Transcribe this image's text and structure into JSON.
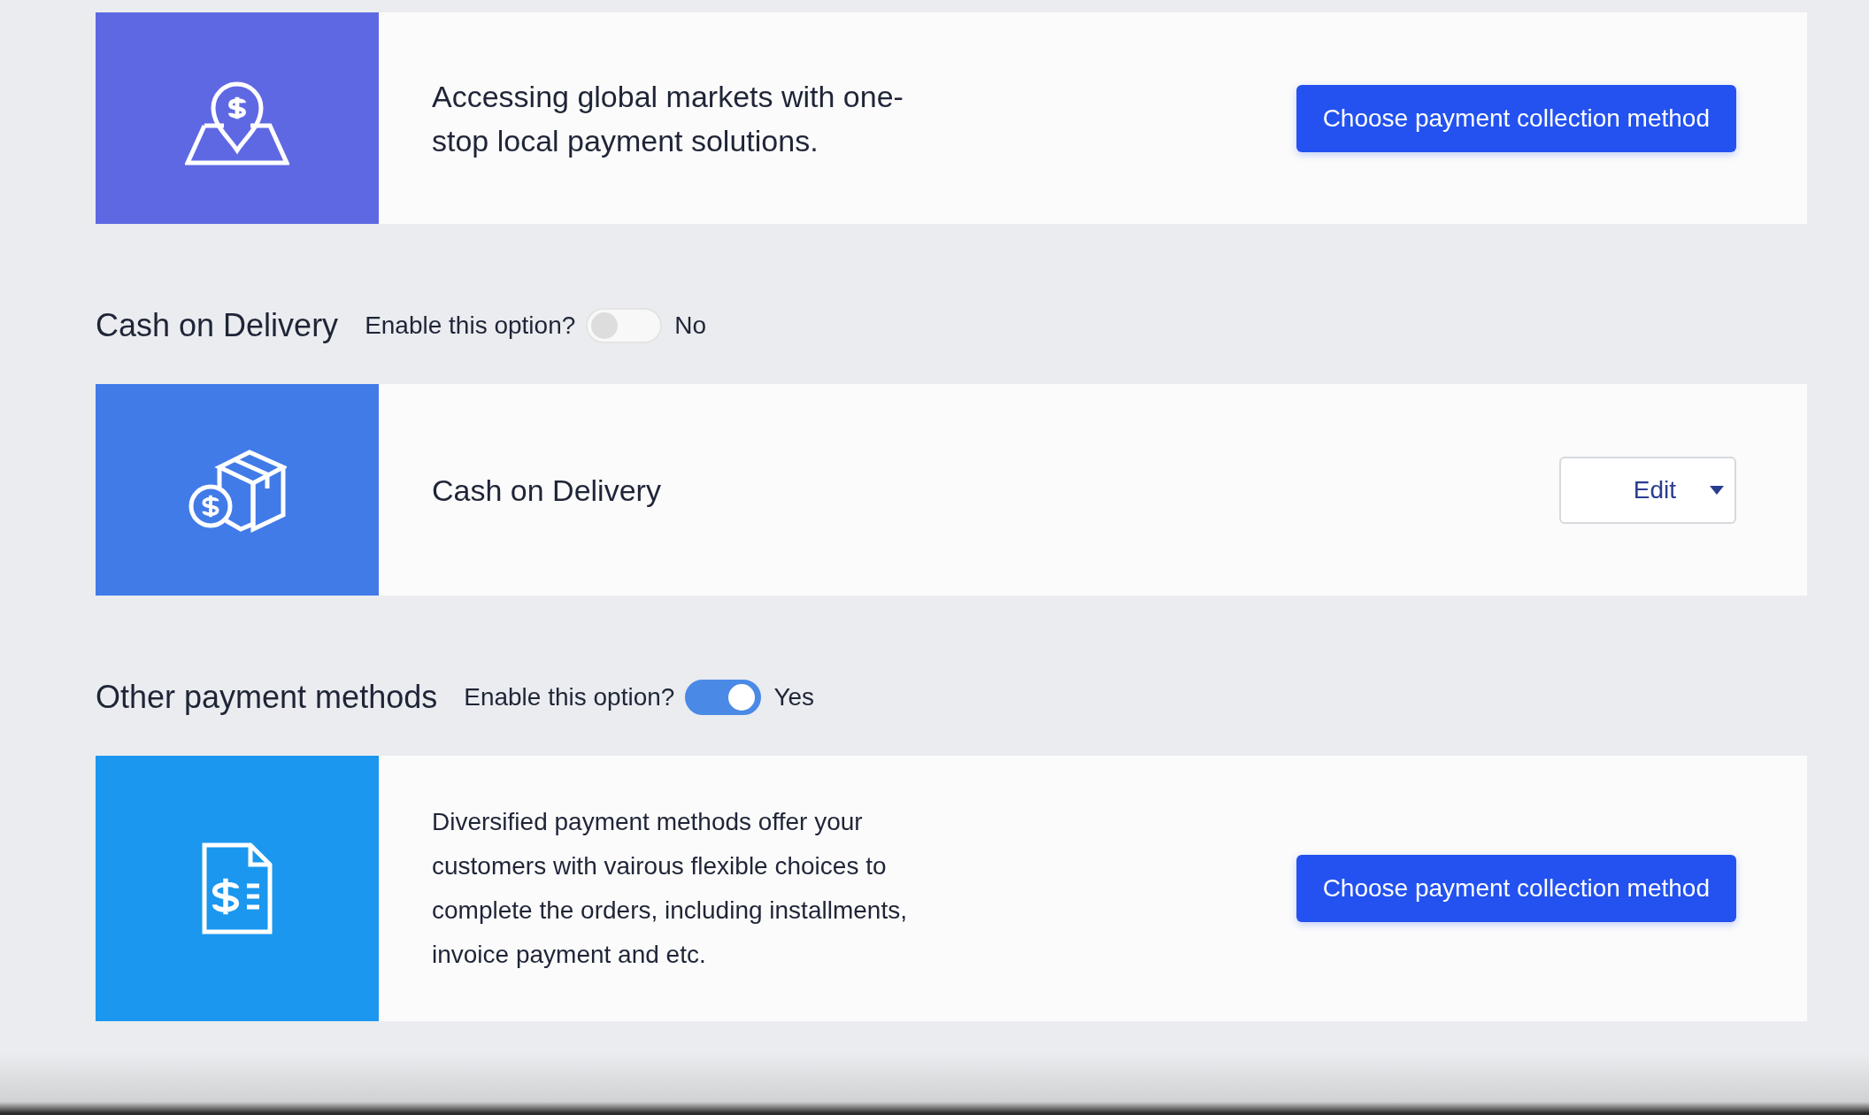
{
  "sections": [
    {
      "card": {
        "kind": "map",
        "color": "#5f68e3",
        "text": "Accessing global markets with one-stop local payment solutions.",
        "action": {
          "kind": "button",
          "label": "Choose payment collection method"
        }
      }
    },
    {
      "header": {
        "title": "Cash on Delivery",
        "enable_label": "Enable this option?",
        "on": false,
        "status": "No"
      },
      "card": {
        "kind": "parcel",
        "color": "#417be8",
        "text": "Cash on Delivery",
        "action": {
          "kind": "dropdown",
          "label": "Edit"
        }
      }
    },
    {
      "header": {
        "title": "Other payment methods",
        "enable_label": "Enable this option?",
        "on": true,
        "status": "Yes"
      },
      "card": {
        "kind": "invoice",
        "color": "#1b97ef",
        "text": "Diversified payment methods offer your customers with vairous flexible choices to complete the orders, including installments, invoice payment and etc.",
        "action": {
          "kind": "button",
          "label": "Choose payment collection method"
        }
      }
    }
  ]
}
